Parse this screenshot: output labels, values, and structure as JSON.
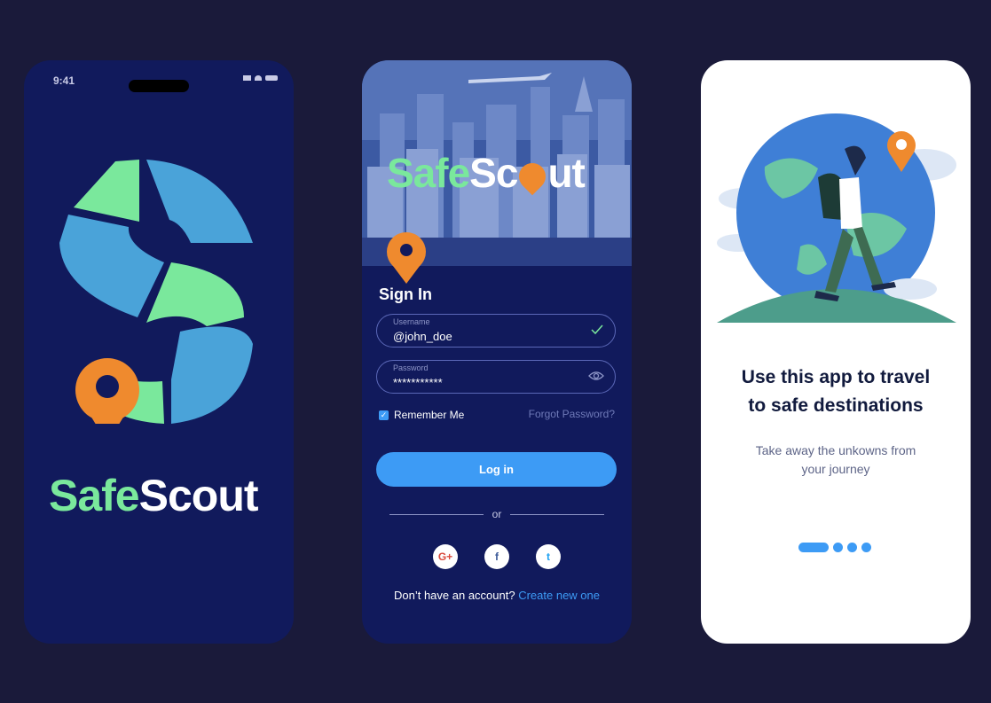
{
  "splash": {
    "status_time": "9:41",
    "brand_left": "Safe",
    "brand_right": "Scout"
  },
  "signin": {
    "brand_left": "Safe",
    "brand_right_a": "Sc",
    "brand_right_b": "ut",
    "title": "Sign In",
    "username_label": "Username",
    "username_value": "@john_doe",
    "password_label": "Password",
    "password_value": "***********",
    "remember_label": "Remember Me",
    "forgot_label": "Forgot Password?",
    "login_label": "Log in",
    "divider_label": "or",
    "signup_prefix": "Don’t have an account?",
    "signup_link": "Create new one",
    "social_icons": [
      "google-plus-icon",
      "facebook-icon",
      "twitter-icon"
    ],
    "social_glyphs": [
      "G+",
      "f",
      "t"
    ]
  },
  "onboarding": {
    "title_line1": "Use this app to travel",
    "title_line2": "to safe destinations",
    "subtitle_line1": "Take away the unkowns from",
    "subtitle_line2": "your journey",
    "page_count": 4,
    "active_page": 1
  },
  "colors": {
    "background": "#1a1a3a",
    "phone_dark": "#111a5c",
    "accent_blue": "#3d9bf5",
    "brand_green": "#7ae89c",
    "pin_orange": "#ef8a2e"
  }
}
